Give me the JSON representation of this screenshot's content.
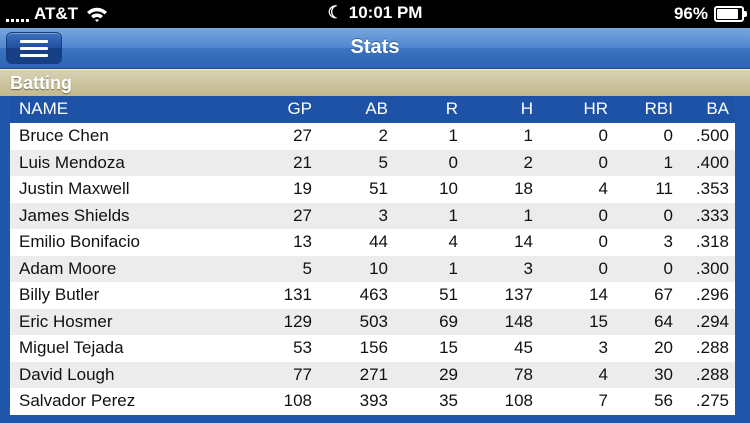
{
  "status_bar": {
    "carrier": "AT&T",
    "time": "10:01 PM",
    "battery": "96%",
    "battery_level": 0.96
  },
  "nav": {
    "title": "Stats"
  },
  "section": {
    "title": "Batting"
  },
  "table": {
    "columns": [
      "NAME",
      "GP",
      "AB",
      "R",
      "H",
      "HR",
      "RBI",
      "BA"
    ],
    "rows": [
      [
        "Bruce Chen",
        "27",
        "2",
        "1",
        "1",
        "0",
        "0",
        ".500"
      ],
      [
        "Luis Mendoza",
        "21",
        "5",
        "0",
        "2",
        "0",
        "1",
        ".400"
      ],
      [
        "Justin Maxwell",
        "19",
        "51",
        "10",
        "18",
        "4",
        "11",
        ".353"
      ],
      [
        "James Shields",
        "27",
        "3",
        "1",
        "1",
        "0",
        "0",
        ".333"
      ],
      [
        "Emilio Bonifacio",
        "13",
        "44",
        "4",
        "14",
        "0",
        "3",
        ".318"
      ],
      [
        "Adam Moore",
        "5",
        "10",
        "1",
        "3",
        "0",
        "0",
        ".300"
      ],
      [
        "Billy Butler",
        "131",
        "463",
        "51",
        "137",
        "14",
        "67",
        ".296"
      ],
      [
        "Eric Hosmer",
        "129",
        "503",
        "69",
        "148",
        "15",
        "64",
        ".294"
      ],
      [
        "Miguel Tejada",
        "53",
        "156",
        "15",
        "45",
        "3",
        "20",
        ".288"
      ],
      [
        "David Lough",
        "77",
        "271",
        "29",
        "78",
        "4",
        "30",
        ".288"
      ],
      [
        "Salvador Perez",
        "108",
        "393",
        "35",
        "108",
        "7",
        "56",
        ".275"
      ]
    ]
  }
}
